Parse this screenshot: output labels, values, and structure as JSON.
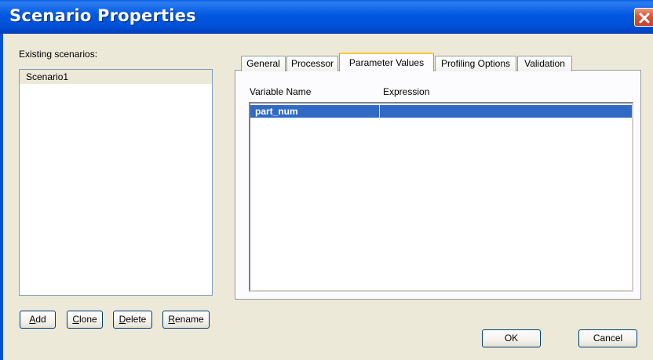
{
  "window": {
    "title": "Scenario Properties"
  },
  "scenarios": {
    "label": "Existing scenarios:",
    "items": [
      "Scenario1"
    ],
    "buttons": {
      "add": {
        "underline": "A",
        "rest": "dd"
      },
      "clone": {
        "underline": "C",
        "rest": "lone"
      },
      "delete": {
        "underline": "D",
        "rest": "elete"
      },
      "rename": {
        "underline": "R",
        "rest": "ename"
      }
    }
  },
  "tabs": [
    {
      "label": "General"
    },
    {
      "label": "Processor"
    },
    {
      "label": "Parameter Values",
      "active": true
    },
    {
      "label": "Profiling Options"
    },
    {
      "label": "Validation"
    }
  ],
  "parameters": {
    "columns": [
      "Variable Name",
      "Expression"
    ],
    "rows": [
      {
        "name": "part_num",
        "expression": "",
        "selected": true
      }
    ]
  },
  "footer": {
    "ok_label": "OK",
    "cancel_label": "Cancel"
  },
  "colors": {
    "titlebar": "#0058e0",
    "selection": "#316ac5",
    "face": "#ece9d8",
    "active_tab_accent": "#ffc83c"
  }
}
